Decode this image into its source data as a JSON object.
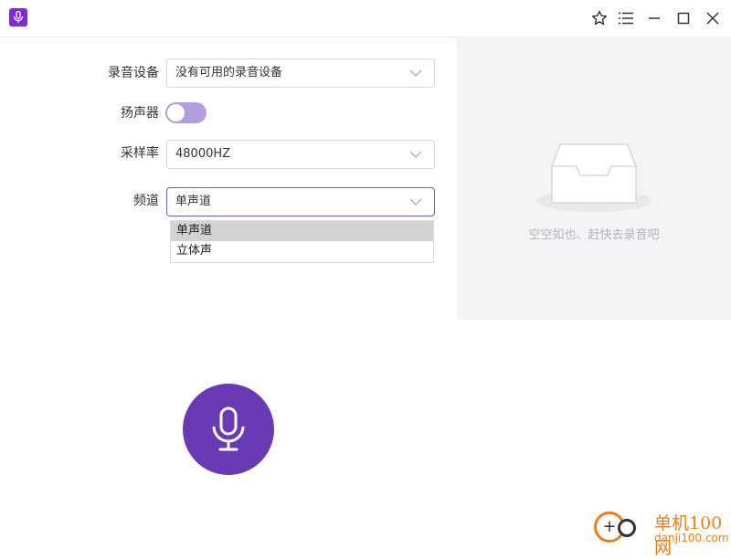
{
  "app": {
    "logo_icon": "microphone-icon",
    "accent_color": "#6a3ab4"
  },
  "titlebar": {
    "buttons": [
      "star-icon",
      "menu-list-icon",
      "minimize-icon",
      "maximize-icon",
      "close-icon"
    ]
  },
  "form": {
    "device": {
      "label": "录音设备",
      "value": "没有可用的录音设备"
    },
    "speaker": {
      "label": "扬声器",
      "enabled": false
    },
    "sample_rate": {
      "label": "采样率",
      "value": "48000HZ"
    },
    "channel": {
      "label": "频道",
      "value": "单声道",
      "options": [
        "单声道",
        "立体声"
      ],
      "selected_index": 0
    }
  },
  "empty_state": {
    "icon": "empty-inbox-icon",
    "text": "空空如也、赶快去录音吧"
  },
  "record_button": {
    "icon": "microphone-icon"
  },
  "watermark": {
    "title": "单机100网",
    "url": "danji100.com"
  }
}
